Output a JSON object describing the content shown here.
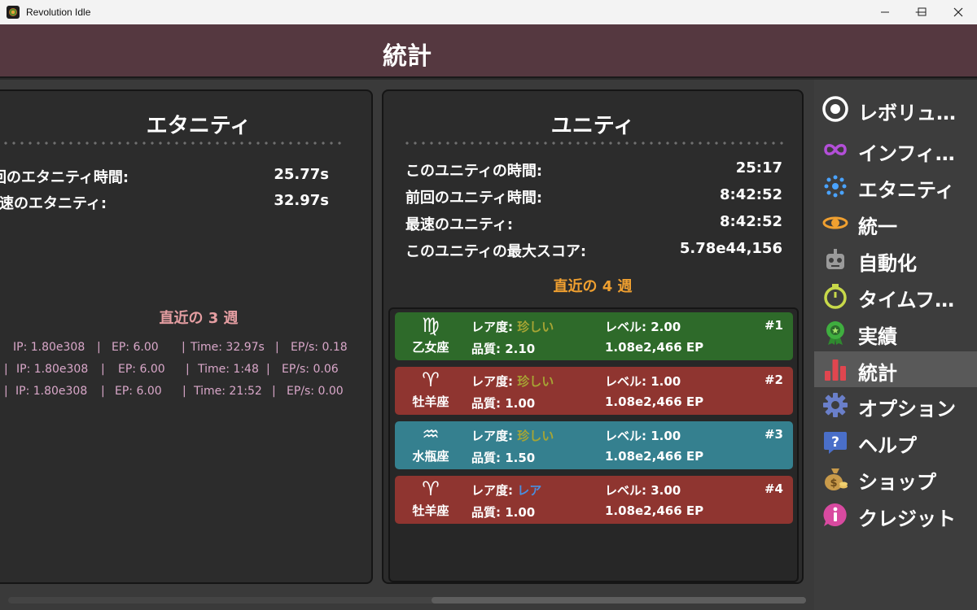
{
  "window": {
    "title": "Revolution Idle"
  },
  "header": {
    "title": "統計"
  },
  "eternity": {
    "title": "エタニティ",
    "stats": [
      {
        "label": "前回のエタニティ時間:",
        "value": "25.77s"
      },
      {
        "label": "最速のエタニティ:",
        "value": "32.97s"
      }
    ],
    "recent_title": "直近の 3 週",
    "recent": [
      {
        "ip": "IP:   1.80e308",
        "ep": "EP:   6.00",
        "time": "Time:   32.97s",
        "eps": "EP/s:   0.18"
      },
      {
        "ip": "IP:   1.80e308",
        "ep": "EP:   6.00",
        "time": "Time:   1:48",
        "eps": "EP/s:   0.06"
      },
      {
        "ip": "IP:   1.80e308",
        "ep": "EP:   6.00",
        "time": "Time:   21:52",
        "eps": "EP/s:   0.00"
      }
    ]
  },
  "unity": {
    "title": "ユニティ",
    "stats": [
      {
        "label": "このユニティの時間:",
        "value": "25:17"
      },
      {
        "label": "前回のユニティ時間:",
        "value": "8:42:52"
      },
      {
        "label": "最速のユニティ:",
        "value": "8:42:52"
      },
      {
        "label": "このユニティの最大スコア:",
        "value": "5.78e44,156"
      }
    ],
    "recent_title": "直近の 4 週",
    "cards": [
      {
        "glyph": "♍",
        "sign": "乙女座",
        "rarity_label": "レア度: ",
        "rarity": "珍しい",
        "quality": "品質: 2.10",
        "level": "レベル: 2.00",
        "ep": "1.08e2,466 EP",
        "rank": "#1",
        "bg": "#2e6a2a",
        "rarity_color": "#a7a534"
      },
      {
        "glyph": "♈",
        "sign": "牡羊座",
        "rarity_label": "レア度: ",
        "rarity": "珍しい",
        "quality": "品質: 1.00",
        "level": "レベル: 1.00",
        "ep": "1.08e2,466 EP",
        "rank": "#2",
        "bg": "#8f3530",
        "rarity_color": "#a7a534"
      },
      {
        "glyph": "♒",
        "sign": "水瓶座",
        "rarity_label": "レア度: ",
        "rarity": "珍しい",
        "quality": "品質: 1.50",
        "level": "レベル: 1.00",
        "ep": "1.08e2,466 EP",
        "rank": "#3",
        "bg": "#35808f",
        "rarity_color": "#a7a534"
      },
      {
        "glyph": "♈",
        "sign": "牡羊座",
        "rarity_label": "レア度: ",
        "rarity": "レア",
        "quality": "品質: 1.00",
        "level": "レベル: 3.00",
        "ep": "1.08e2,466 EP",
        "rank": "#4",
        "bg": "#8f3530",
        "rarity_color": "#4a8fe0"
      }
    ]
  },
  "sidebar": {
    "items": [
      {
        "label": "レボリュ…",
        "icon": "target-icon",
        "color": "#ffffff"
      },
      {
        "label": "インフィ…",
        "icon": "infinity-icon",
        "color": "#b34fd8"
      },
      {
        "label": "エタニティ",
        "icon": "eternity-dots-icon",
        "color": "#4aa3ff"
      },
      {
        "label": "統一",
        "icon": "unity-orbit-icon",
        "color": "#f0a030"
      },
      {
        "label": "自動化",
        "icon": "robot-icon",
        "color": "#9a9a9a"
      },
      {
        "label": "タイムフ…",
        "icon": "stopwatch-icon",
        "color": "#c8d94a"
      },
      {
        "label": "実績",
        "icon": "medal-icon",
        "color": "#3fae3f"
      },
      {
        "label": "統計",
        "icon": "bar-chart-icon",
        "color": "#e0464f"
      },
      {
        "label": "オプション",
        "icon": "gear-icon",
        "color": "#6a7fc9"
      },
      {
        "label": "ヘルプ",
        "icon": "help-icon",
        "color": "#4a6fc9"
      },
      {
        "label": "ショップ",
        "icon": "money-bag-icon",
        "color": "#c89a4a"
      },
      {
        "label": "クレジット",
        "icon": "info-icon",
        "color": "#d84aa0"
      }
    ],
    "active_index": 7
  }
}
